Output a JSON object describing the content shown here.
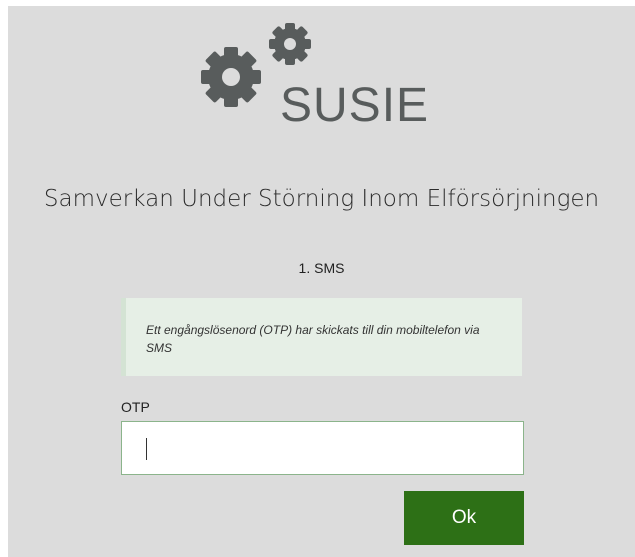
{
  "logo": {
    "text": "SUSIE",
    "icon": "gears-icon",
    "color": "#585c5c"
  },
  "subtitle": "Samverkan Under Störning Inom Elförsörjningen",
  "step_label": "1. SMS",
  "info": {
    "text": "Ett engångslösenord (OTP) har skickats till din mobiltelefon via SMS"
  },
  "form": {
    "otp_label": "OTP",
    "otp_value": "",
    "ok_label": "Ok"
  },
  "colors": {
    "panel_bg": "#dcdcdc",
    "info_bg": "#e6efe6",
    "button_bg": "#2d7016",
    "input_border": "#8bb48b"
  }
}
